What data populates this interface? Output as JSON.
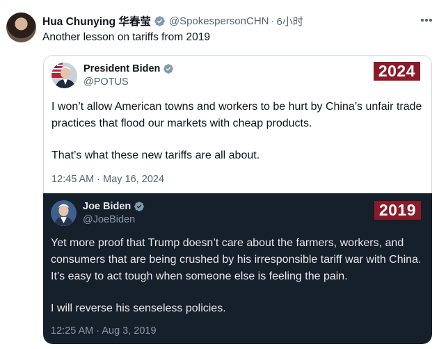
{
  "post": {
    "display_name": "Hua Chunying 华春莹",
    "handle": "@SpokespersonCHN",
    "separator": "·",
    "time": "6小时",
    "text": "Another lesson on tariffs from 2019",
    "more_icon": "more-horizontal-icon",
    "verified_icon": "verified-badge-icon",
    "verified_color": "#829aab"
  },
  "quotes": [
    {
      "name": "President Biden",
      "handle": "@POTUS",
      "year": "2024",
      "paragraphs": [
        "I won’t allow American towns and workers to be hurt by China’s unfair trade practices that flood our markets with cheap products.",
        "That’s what these new tariffs are all about."
      ],
      "timestamp": "12:45 AM · May 16, 2024",
      "theme": "light"
    },
    {
      "name": "Joe Biden",
      "handle": "@JoeBiden",
      "year": "2019",
      "paragraphs": [
        "Yet more proof that Trump doesn’t care about the farmers, workers, and consumers that are being crushed by his irresponsible tariff war with China. It’s easy to act tough when someone else is feeling the pain.",
        "I will reverse his senseless policies."
      ],
      "timestamp": "12:25 AM · Aug 3, 2019",
      "theme": "dark"
    }
  ],
  "colors": {
    "badge_background": "#8b1a2a",
    "dark_card_background": "#15202b",
    "secondary_text": "#536471"
  }
}
